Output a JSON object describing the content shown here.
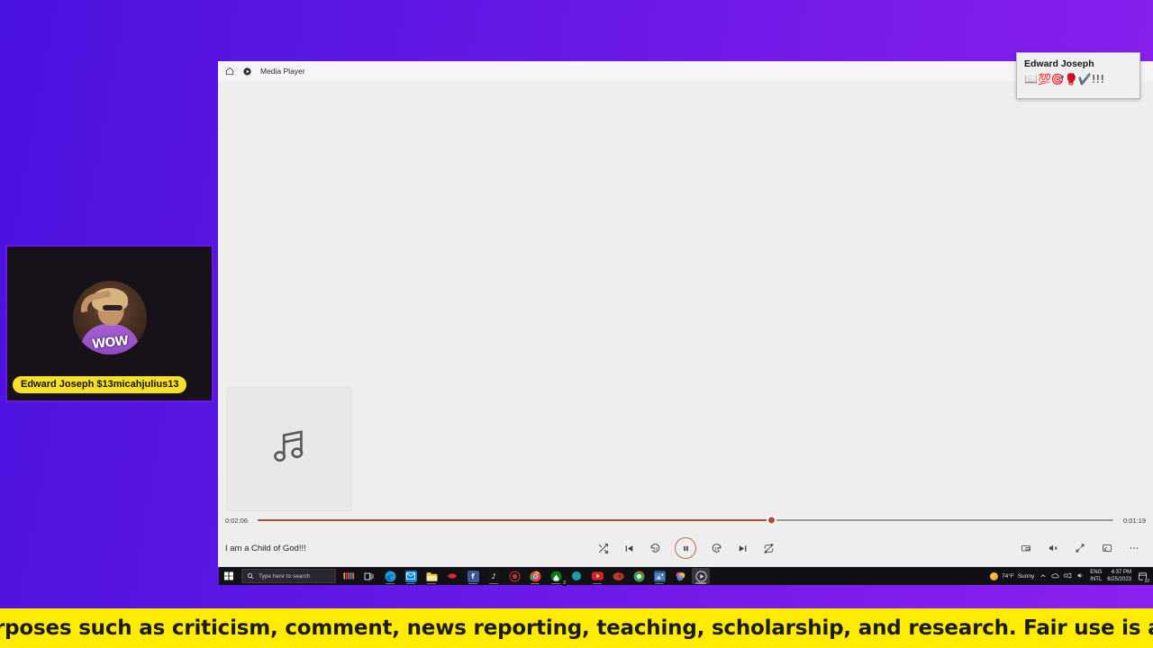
{
  "desktop": {
    "background_from": "#4a12df",
    "background_to": "#8d20f0"
  },
  "thumbnail": {
    "label": "Edward Joseph $13micahjulius13",
    "avatar_text": "WOW",
    "label_bg": "#f7e02a"
  },
  "notification": {
    "name": "Edward Joseph",
    "message": "📖💯🎯🥊✔️!!!"
  },
  "window": {
    "title": "Media Player",
    "home_icon": "home-icon",
    "app_icon": "media-player-icon"
  },
  "player": {
    "album_art_icon": "music-note-icon",
    "now_playing_title": "I am a Child of God!!!",
    "elapsed_time": "0:02:06",
    "total_time": "0:01:19",
    "progress_percent": 60,
    "accent_color": "#a6502c",
    "controls": [
      {
        "name": "shuffle-button",
        "label": "Shuffle"
      },
      {
        "name": "previous-button",
        "label": "Previous"
      },
      {
        "name": "rewind-10-button",
        "label": "Rewind 10 seconds"
      },
      {
        "name": "pause-button",
        "label": "Pause"
      },
      {
        "name": "forward-30-button",
        "label": "Forward 30 seconds"
      },
      {
        "name": "next-button",
        "label": "Next"
      },
      {
        "name": "repeat-off-button",
        "label": "Repeat off"
      }
    ],
    "right_controls": [
      {
        "name": "mini-player-button",
        "label": "Mini player"
      },
      {
        "name": "volume-mute-button",
        "label": "Volume muted"
      },
      {
        "name": "fullscreen-button",
        "label": "Full screen"
      },
      {
        "name": "cast-button",
        "label": "Cast to device"
      },
      {
        "name": "more-options-button",
        "label": "See more"
      }
    ]
  },
  "taskbar": {
    "start_label": "Start",
    "search_placeholder": "Type here to search",
    "apps": [
      {
        "name": "taskbar-app-weather",
        "glyph": "",
        "color": "#f2b705"
      },
      {
        "name": "taskbar-app-task-view",
        "glyph": "",
        "color": "#2a2730"
      },
      {
        "name": "taskbar-app-edge",
        "glyph": "",
        "color": "#1b9de2"
      },
      {
        "name": "taskbar-app-mail",
        "glyph": "",
        "color": "#0a84d8"
      },
      {
        "name": "taskbar-app-file-explorer",
        "glyph": "",
        "color": "#f7c24a"
      },
      {
        "name": "taskbar-app-red",
        "glyph": "",
        "color": "#d92c2c"
      },
      {
        "name": "taskbar-app-facebook",
        "glyph": "f",
        "color": "#3b5998"
      },
      {
        "name": "taskbar-app-tiktok",
        "glyph": "♪",
        "color": "#111111"
      },
      {
        "name": "taskbar-app-record",
        "glyph": "",
        "color": "#8c1b1b"
      },
      {
        "name": "taskbar-app-chrome",
        "glyph": "",
        "color": "#e8453c"
      },
      {
        "name": "taskbar-app-xbox",
        "glyph": "",
        "color": "#107c10"
      },
      {
        "name": "taskbar-app-teal",
        "glyph": "",
        "color": "#17a0a8"
      },
      {
        "name": "taskbar-app-youtube",
        "glyph": "",
        "color": "#e02020"
      },
      {
        "name": "taskbar-app-crimson",
        "glyph": "",
        "color": "#c0392b"
      },
      {
        "name": "taskbar-app-chrome2",
        "glyph": "",
        "color": "#3ba34b"
      },
      {
        "name": "taskbar-app-photos",
        "glyph": "",
        "color": "#4a82c4"
      },
      {
        "name": "taskbar-app-colorful",
        "glyph": "",
        "color": "#d75ba0"
      },
      {
        "name": "taskbar-app-media-player",
        "glyph": "",
        "color": "#3c3c3c"
      }
    ],
    "xbox_badge": "2",
    "tray": {
      "weather_temp": "74°F",
      "weather_condition": "Sunny",
      "language_line1": "ENG",
      "language_line2": "INTL",
      "time": "4:37 PM",
      "date": "6/25/2023",
      "notification_count": "10"
    }
  },
  "banner": {
    "text": "rposes such as criticism, comment, news reporting, teaching, scholarship, and research. Fair use is a use p"
  }
}
